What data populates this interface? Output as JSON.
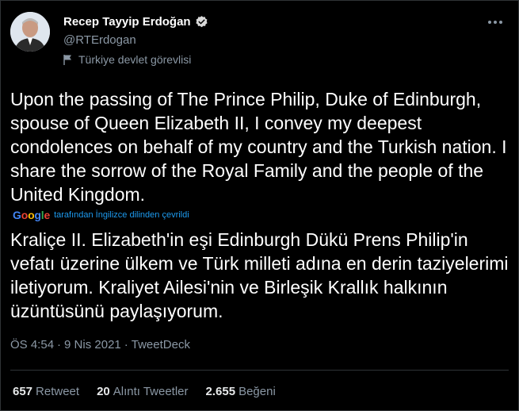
{
  "user": {
    "display_name": "Recep Tayyip Erdoğan",
    "handle": "@RTErdogan",
    "label": "Türkiye devlet görevlisi",
    "verified": true
  },
  "tweet": {
    "text": "Upon the passing of The Prince Philip, Duke of Edinburgh, spouse of Queen Elizabeth II, I convey my deepest condolences on behalf of my country and the Turkish nation. I share the sorrow of the Royal Family and the people of the United Kingdom.",
    "translation_provider": "Google",
    "translation_note": "tarafından İngilizce dilinden çevrildi",
    "translated_text": "Kraliçe II. Elizabeth'in eşi Edinburgh Dükü Prens Philip'in vefatı üzerine ülkem ve Türk milleti adına en derin taziyelerimi iletiyorum. Kraliyet Ailesi'nin ve Birleşik Krallık halkının üzüntüsünü paylaşıyorum.",
    "time": "ÖS 4:54",
    "date": "9 Nis 2021",
    "source": "TweetDeck",
    "separator": "·"
  },
  "stats": {
    "retweets": {
      "count": "657",
      "label": "Retweet"
    },
    "quotes": {
      "count": "20",
      "label": "Alıntı Tweetler"
    },
    "likes": {
      "count": "2.655",
      "label": "Beğeni"
    }
  },
  "colors": {
    "background": "#000000",
    "link": "#1d9bf0",
    "muted": "#8b98a5",
    "verified": "#d9d9d9"
  },
  "icons": {
    "verified": "verified-badge-icon",
    "label": "flag-icon",
    "more": "more-options-icon"
  }
}
